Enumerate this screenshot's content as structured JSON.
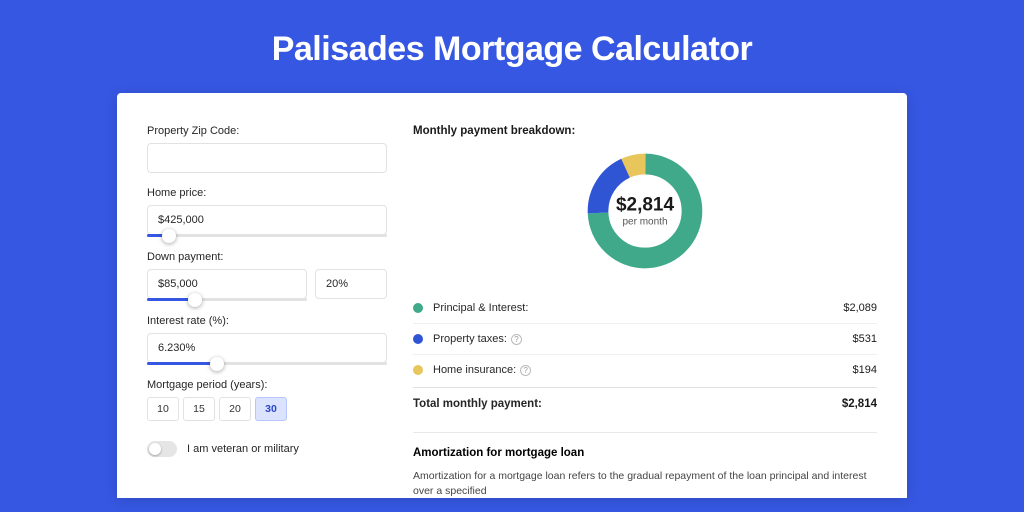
{
  "header": {
    "title": "Palisades Mortgage Calculator"
  },
  "form": {
    "zip": {
      "label": "Property Zip Code:",
      "value": ""
    },
    "price": {
      "label": "Home price:",
      "value": "$425,000",
      "slider_pct": 9
    },
    "down": {
      "label": "Down payment:",
      "amount": "$85,000",
      "pct": "20%",
      "slider_pct": 20
    },
    "rate": {
      "label": "Interest rate (%):",
      "value": "6.230%",
      "slider_pct": 29
    },
    "period": {
      "label": "Mortgage period (years):",
      "options": [
        "10",
        "15",
        "20",
        "30"
      ],
      "active": "30"
    },
    "vet": {
      "label": "I am veteran or military"
    }
  },
  "breakdown": {
    "title": "Monthly payment breakdown:",
    "center_value": "$2,814",
    "center_sub": "per month",
    "items": [
      {
        "label": "Principal & Interest:",
        "value": "$2,089",
        "color": "#3fa98a",
        "help": false
      },
      {
        "label": "Property taxes:",
        "value": "$531",
        "color": "#2f55d4",
        "help": true
      },
      {
        "label": "Home insurance:",
        "value": "$194",
        "color": "#e8c65b",
        "help": true
      }
    ],
    "total_label": "Total monthly payment:",
    "total_value": "$2,814"
  },
  "chart_data": {
    "type": "pie",
    "title": "Monthly payment breakdown",
    "series": [
      {
        "name": "Principal & Interest",
        "value": 2089,
        "color": "#3fa98a"
      },
      {
        "name": "Property taxes",
        "value": 531,
        "color": "#2f55d4"
      },
      {
        "name": "Home insurance",
        "value": 194,
        "color": "#e8c65b"
      }
    ],
    "total": 2814,
    "center_label": "$2,814 per month"
  },
  "amortization": {
    "title": "Amortization for mortgage loan",
    "body": "Amortization for a mortgage loan refers to the gradual repayment of the loan principal and interest over a specified"
  }
}
